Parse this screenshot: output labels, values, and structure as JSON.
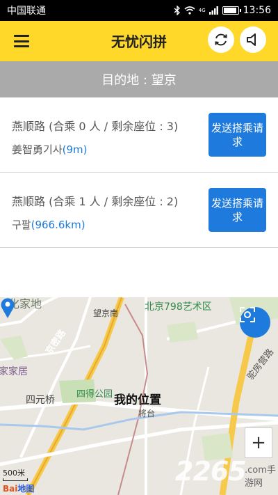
{
  "status_bar": {
    "carrier": "中国联通",
    "network": "4G",
    "time": "13:56",
    "battery_level": 0.9
  },
  "header": {
    "title": "无忧闪拼"
  },
  "destination": {
    "text": "目的地 : 望京"
  },
  "rides": [
    {
      "title": "燕顺路 (合乘 0 人 / 剩余座位 : 3)",
      "driver": "姜智勇",
      "driver_suffix": "기사",
      "distance": "(9m)",
      "button": "发送搭乘请求"
    },
    {
      "title": "燕顺路 (合乘 1 人 / 剩余座位 : 2)",
      "driver": "구팔",
      "driver_suffix": "",
      "distance": "(966.6km)",
      "button": "发送搭乘请求"
    }
  ],
  "map": {
    "labels": {
      "huajiadi": "化家地",
      "wangjingnan": "望京南",
      "art798": "北京798艺术区",
      "jiajia": "家家居",
      "jingmi": "京密路",
      "siqiao": "四元桥",
      "park": "四得公园",
      "jiangtai": "将台",
      "tuofang": "驼房营路"
    },
    "my_position": "我的位置",
    "zoom_in": "+",
    "scale": "500米",
    "logo_part1": "Bai",
    "logo_part2": "地图",
    "watermark": "2265",
    "watermark_sub": ".com手游网"
  },
  "colors": {
    "header_bg": "#FFD829",
    "dest_bg": "#AAAAAA",
    "button_blue": "#1E7BDD",
    "distance_blue": "#1E7BD6"
  }
}
